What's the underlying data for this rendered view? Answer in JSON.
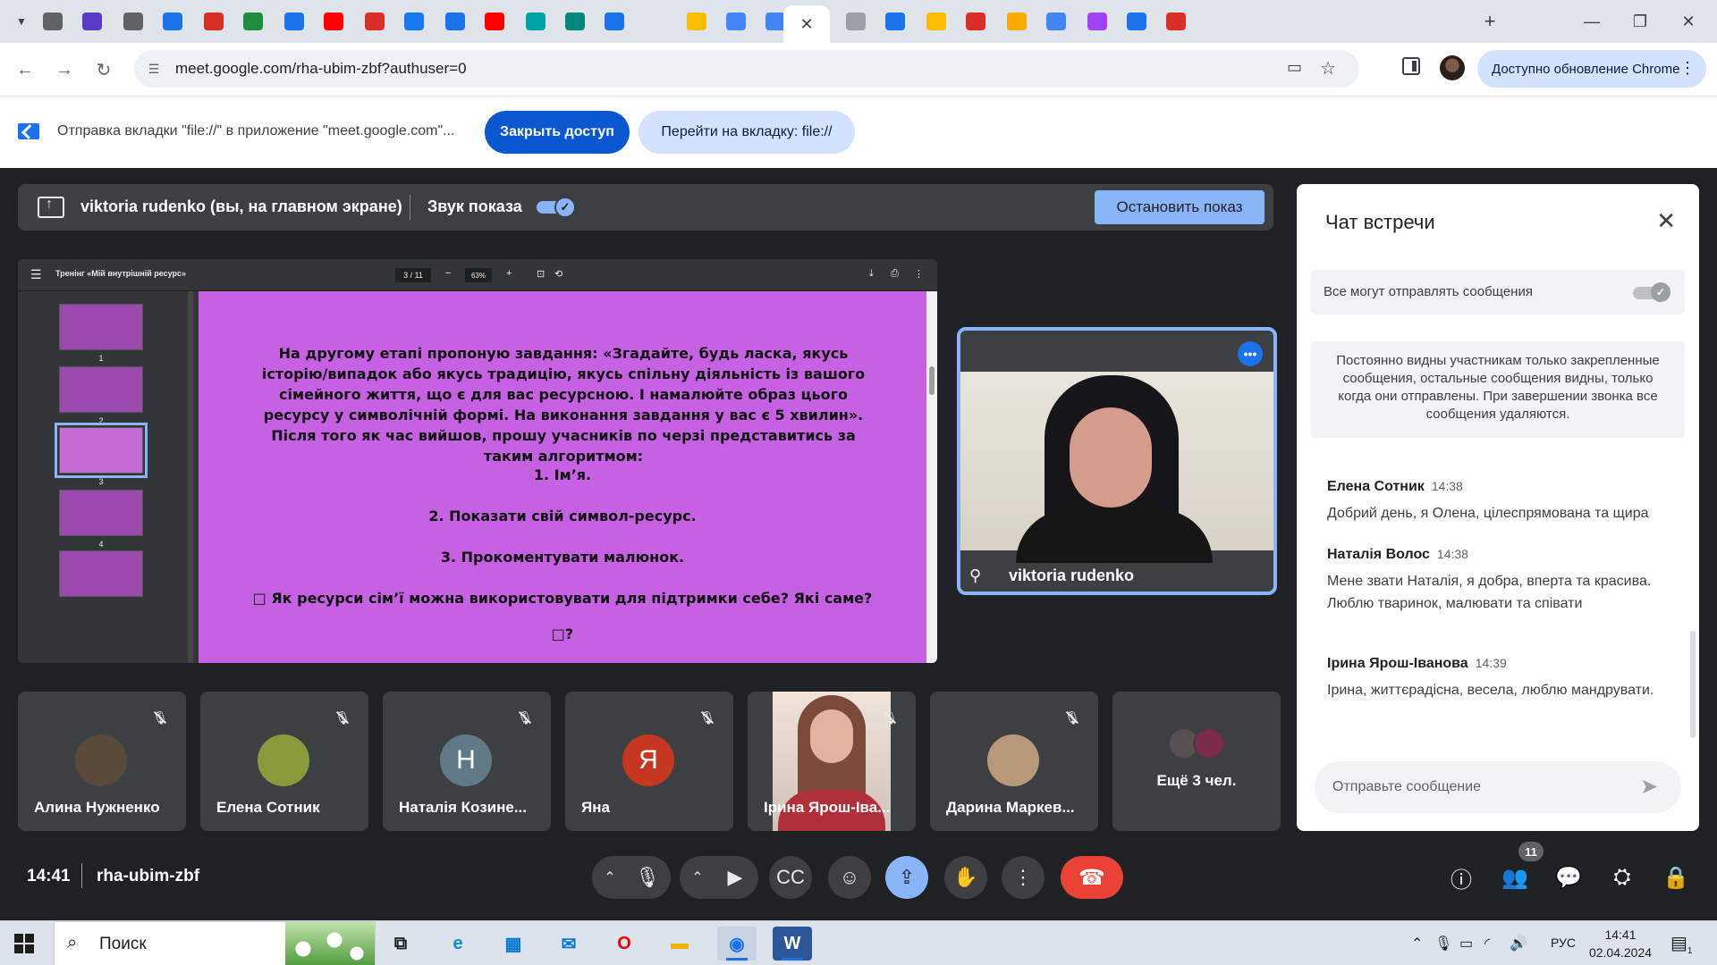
{
  "browser": {
    "url": "meet.google.com/rha-ubim-zbf?authuser=0",
    "update_button": "Доступно обновление Chrome",
    "tab_icons": [
      {
        "icon": "chrome-icon",
        "color": "#5f6368"
      },
      {
        "icon": "shield-icon",
        "color": "#5b3cc4"
      },
      {
        "icon": "globe-icon",
        "color": "#5f6368"
      },
      {
        "icon": "bookmark-icon",
        "color": "#1a73e8"
      },
      {
        "icon": "heart-icon",
        "color": "#d93025"
      },
      {
        "icon": "sheets-icon",
        "color": "#1e8e3e"
      },
      {
        "icon": "target-icon",
        "color": "#1a73e8"
      },
      {
        "icon": "youtube-icon",
        "color": "#ff0000"
      },
      {
        "icon": "gmail-icon",
        "color": "#d93025"
      },
      {
        "icon": "facebook-icon",
        "color": "#1877f2"
      },
      {
        "icon": "record-icon",
        "color": "#1a73e8"
      },
      {
        "icon": "youtube-icon",
        "color": "#ff0000"
      },
      {
        "icon": "c-icon",
        "color": "#00a3a3"
      },
      {
        "icon": "meet-icon",
        "color": "#00897b"
      },
      {
        "icon": "calendar-icon",
        "color": "#1a73e8"
      },
      {
        "icon": "drive-icon",
        "color": "#fbbc04"
      },
      {
        "icon": "docs-icon",
        "color": "#4285f4"
      },
      {
        "icon": "docs-icon",
        "color": "#4285f4"
      },
      {
        "icon": "youtube-icon",
        "color": "#ff0000"
      },
      {
        "icon": "target-icon",
        "color": "#9aa0a6"
      },
      {
        "icon": "snowflake-icon",
        "color": "#1a73e8"
      },
      {
        "icon": "doc-icon",
        "color": "#fbbc04"
      },
      {
        "icon": "gmail-icon",
        "color": "#d93025"
      },
      {
        "icon": "bell-icon",
        "color": "#f9ab00"
      },
      {
        "icon": "google-icon",
        "color": "#4285f4"
      },
      {
        "icon": "chat-icon",
        "color": "#a142f4"
      },
      {
        "icon": "screen-icon",
        "color": "#1a73e8"
      },
      {
        "icon": "gmail-icon",
        "color": "#d93025"
      }
    ]
  },
  "infobar": {
    "message": "Отправка вкладки \"file://\" в приложение \"meet.google.com\"...",
    "stop_access": "Закрыть доступ",
    "go_to_tab": "Перейти на вкладку: file://"
  },
  "presentation": {
    "presenter": "viktoria rudenko (вы, на главном экране)",
    "audio_label": "Звук показа",
    "audio_on": true,
    "stop_button": "Остановить показ"
  },
  "pdf": {
    "title": "Тренінг «Мій внутрішній ресурс»",
    "page_current": "3",
    "page_total": "/ 11",
    "zoom": "63%",
    "thumbnails": [
      "1",
      "2",
      "3",
      "4"
    ],
    "selected_page": "3",
    "slide_paragraph": "На другому етапі  пропоную завдання: «Згадайте, будь ласка, якусь історію/випадок або якусь традицію, якусь спільну діяльність із вашого сімейного життя, що є для вас ресурсною. І намалюйте образ цього ресурсу у символічній формі. На виконання завдання у вас є 5 хвилин». Після того як час вийшов, прошу учасників по черзі представитись за таким алгоритмом:",
    "steps": [
      "1. Ім’я.",
      "2. Показати свій символ-ресурс.",
      "3. Прокоментувати малюнок.",
      "□ Як ресурси сім’ї можна використовувати для підтримки себе? Які саме?",
      "□?"
    ]
  },
  "presenter_tile": {
    "name": "viktoria rudenko"
  },
  "participants": [
    {
      "name": "Алина Нужненко",
      "type": "photo",
      "color": "#5a4a3a"
    },
    {
      "name": "Елена Сотник",
      "type": "photo",
      "color": "#8a9a3a"
    },
    {
      "name": "Наталія Козине...",
      "type": "initial",
      "initial": "Н",
      "color": "#5f7a86"
    },
    {
      "name": "Яна",
      "type": "initial",
      "initial": "Я",
      "color": "#c5371f"
    },
    {
      "name": "Ірина Ярош-Іва...",
      "type": "video"
    },
    {
      "name": "Дарина Маркев...",
      "type": "photo",
      "color": "#b89a7a"
    }
  ],
  "more_participants": "Ещё 3 чел.",
  "chat": {
    "title": "Чат встречи",
    "permission_label": "Все могут отправлять сообщения",
    "notice": "Постоянно видны участникам только закрепленные сообщения, остальные сообщения видны, только когда они отправлены. При завершении звонка все сообщения удаляются.",
    "messages": [
      {
        "sender": "Елена Сотник",
        "time": "14:38",
        "text": "Добрий день, я Олена, цілеспрямована та щира"
      },
      {
        "sender": "Наталія Волос",
        "time": "14:38",
        "text": "Мене звати Наталія, я добра, вперта та красива. Люблю тваринок, малювати та співати"
      },
      {
        "sender": "Ірина Ярош-Іванова",
        "time": "14:39",
        "text": "Ірина, життєрадісна, весела, люблю мандрувати."
      }
    ],
    "input_placeholder": "Отправьте сообщение"
  },
  "meeting": {
    "time": "14:41",
    "code": "rha-ubim-zbf",
    "people_count": "11"
  },
  "taskbar": {
    "search_placeholder": "Поиск",
    "language": "РУС",
    "clock_time": "14:41",
    "clock_date": "02.04.2024",
    "notification_count": "1"
  }
}
